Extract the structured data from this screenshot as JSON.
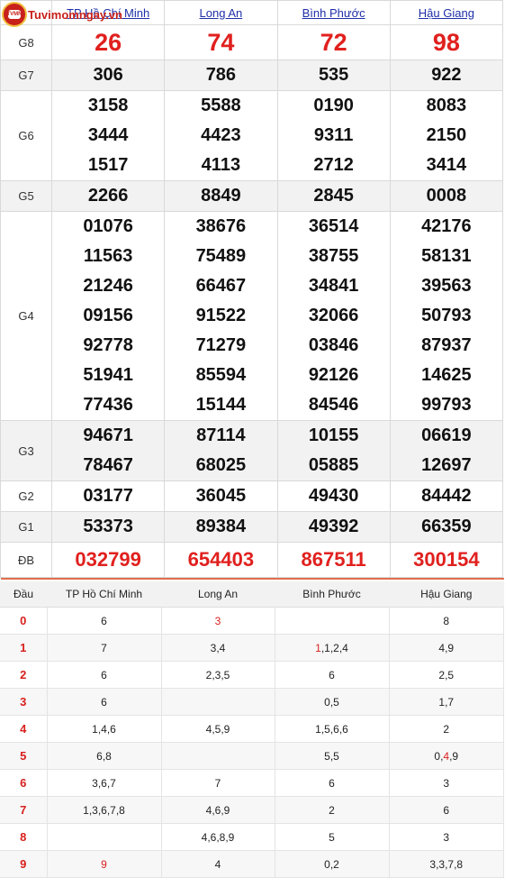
{
  "logo": {
    "text": "Tuvimomngay.vn",
    "badge": "TVMN"
  },
  "provinces": [
    "TP Hồ Chí Minh",
    "Long An",
    "Bình Phước",
    "Hậu Giang"
  ],
  "prizes": [
    {
      "label": "G8",
      "rows": [
        [
          "26",
          "74",
          "72",
          "98"
        ]
      ],
      "style": "big"
    },
    {
      "label": "G7",
      "rows": [
        [
          "306",
          "786",
          "535",
          "922"
        ]
      ]
    },
    {
      "label": "G6",
      "rows": [
        [
          "3158",
          "5588",
          "0190",
          "8083"
        ],
        [
          "3444",
          "4423",
          "9311",
          "2150"
        ],
        [
          "1517",
          "4113",
          "2712",
          "3414"
        ]
      ]
    },
    {
      "label": "G5",
      "rows": [
        [
          "2266",
          "8849",
          "2845",
          "0008"
        ]
      ]
    },
    {
      "label": "G4",
      "rows": [
        [
          "01076",
          "38676",
          "36514",
          "42176"
        ],
        [
          "11563",
          "75489",
          "38755",
          "58131"
        ],
        [
          "21246",
          "66467",
          "34841",
          "39563"
        ],
        [
          "09156",
          "91522",
          "32066",
          "50793"
        ],
        [
          "92778",
          "71279",
          "03846",
          "87937"
        ],
        [
          "51941",
          "85594",
          "92126",
          "14625"
        ],
        [
          "77436",
          "15144",
          "84546",
          "99793"
        ]
      ]
    },
    {
      "label": "G3",
      "rows": [
        [
          "94671",
          "87114",
          "10155",
          "06619"
        ],
        [
          "78467",
          "68025",
          "05885",
          "12697"
        ]
      ]
    },
    {
      "label": "G2",
      "rows": [
        [
          "03177",
          "36045",
          "49430",
          "84442"
        ]
      ]
    },
    {
      "label": "G1",
      "rows": [
        [
          "53373",
          "89384",
          "49392",
          "66359"
        ]
      ]
    },
    {
      "label": "ĐB",
      "rows": [
        [
          "032799",
          "654403",
          "867511",
          "300154"
        ]
      ],
      "style": "db"
    }
  ],
  "loto": {
    "header_first": "Đầu",
    "rows": [
      {
        "head": "0",
        "cells": [
          [
            "6"
          ],
          [
            {
              "t": "3",
              "red": true
            }
          ],
          [],
          [
            "8"
          ]
        ]
      },
      {
        "head": "1",
        "cells": [
          [
            "7"
          ],
          [
            "3,4"
          ],
          [
            {
              "t": "1",
              "red": true
            },
            ",1,2,4"
          ],
          [
            "4,9"
          ]
        ]
      },
      {
        "head": "2",
        "cells": [
          [
            "6"
          ],
          [
            "2,3,5"
          ],
          [
            "6"
          ],
          [
            "2,5"
          ]
        ]
      },
      {
        "head": "3",
        "cells": [
          [
            "6"
          ],
          [],
          [
            "0,5"
          ],
          [
            "1,7"
          ]
        ]
      },
      {
        "head": "4",
        "cells": [
          [
            "1,4,6"
          ],
          [
            "4,5,9"
          ],
          [
            "1,5,6,6"
          ],
          [
            "2"
          ]
        ]
      },
      {
        "head": "5",
        "cells": [
          [
            "6,8"
          ],
          [],
          [
            "5,5"
          ],
          [
            "0,",
            {
              "t": "4",
              "red": true
            },
            ",9"
          ]
        ]
      },
      {
        "head": "6",
        "cells": [
          [
            "3,6,7"
          ],
          [
            "7"
          ],
          [
            "6"
          ],
          [
            "3"
          ]
        ]
      },
      {
        "head": "7",
        "cells": [
          [
            "1,3,6,7,8"
          ],
          [
            "4,6,9"
          ],
          [
            "2"
          ],
          [
            "6"
          ]
        ]
      },
      {
        "head": "8",
        "cells": [
          [],
          [
            "4,6,8,9"
          ],
          [
            "5"
          ],
          [
            "3"
          ]
        ]
      },
      {
        "head": "9",
        "cells": [
          [
            {
              "t": "9",
              "red": true
            }
          ],
          [
            "4"
          ],
          [
            "0,2"
          ],
          [
            "3,3,7,8"
          ]
        ]
      }
    ]
  },
  "colors": {
    "accent": "#e0201e",
    "link": "#1f2fa8",
    "border": "#e07050"
  }
}
